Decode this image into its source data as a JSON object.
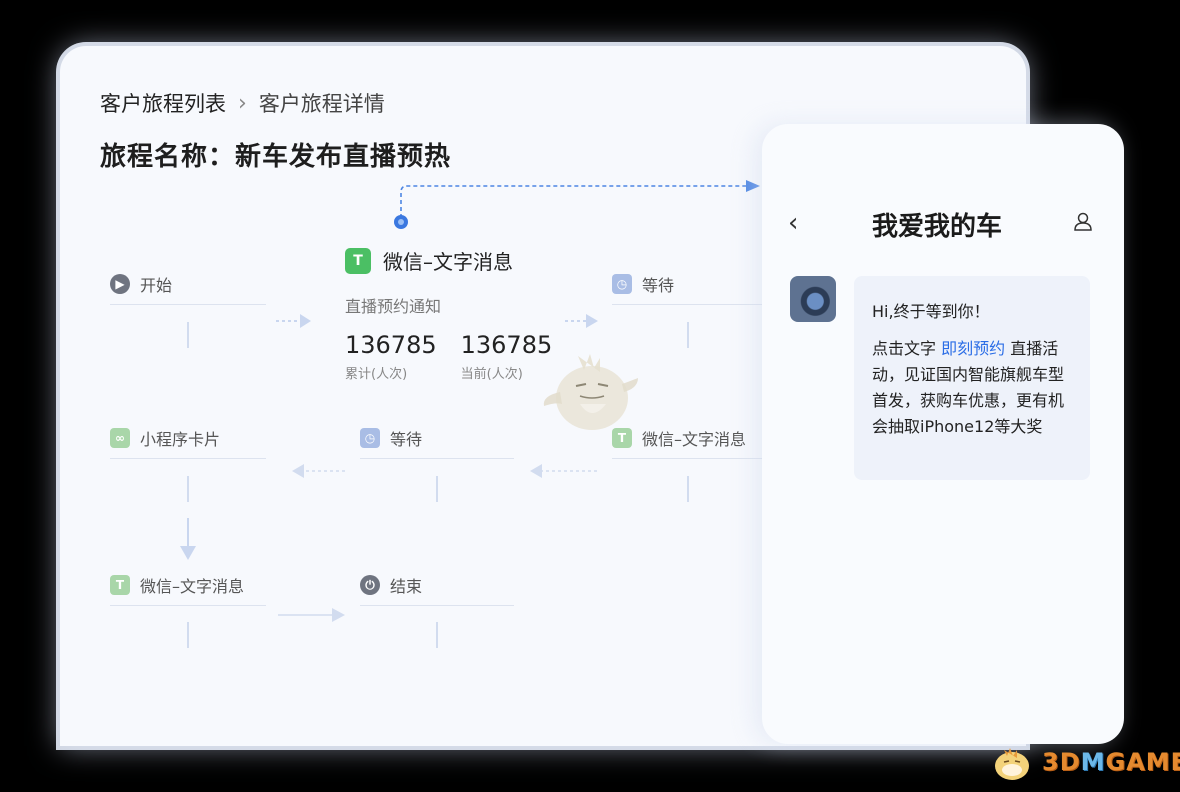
{
  "breadcrumb": {
    "parent": "客户旅程列表",
    "current": "客户旅程详情"
  },
  "journey": {
    "title": "旅程名称：新车发布直播预热"
  },
  "flow": {
    "start": "开始",
    "wechat_main": {
      "title": "微信–文字消息",
      "subtitle": "直播预约通知",
      "total_value": "136785",
      "total_label": "累计(人次)",
      "current_value": "136785",
      "current_label": "当前(人次)"
    },
    "wait_1": "等待",
    "mini_program": "小程序卡片",
    "wait_2": "等待",
    "wechat_2": "微信–文字消息",
    "wechat_3": "微信–文字消息",
    "end": "结束"
  },
  "phone": {
    "title": "我爱我的车",
    "greeting": "Hi,终于等到你！",
    "msg_before": "点击文字 ",
    "msg_link": "即刻预约",
    "msg_after": " 直播活动，见证国内智能旗舰车型首发，获购车优惠，更有机会抽取iPhone12等大奖"
  },
  "watermark": {
    "brand_a": "3D",
    "brand_b": "M",
    "brand_c": "GAME"
  },
  "colors": {
    "accent": "#2a6de6",
    "wechat_green": "#4bbf64"
  }
}
